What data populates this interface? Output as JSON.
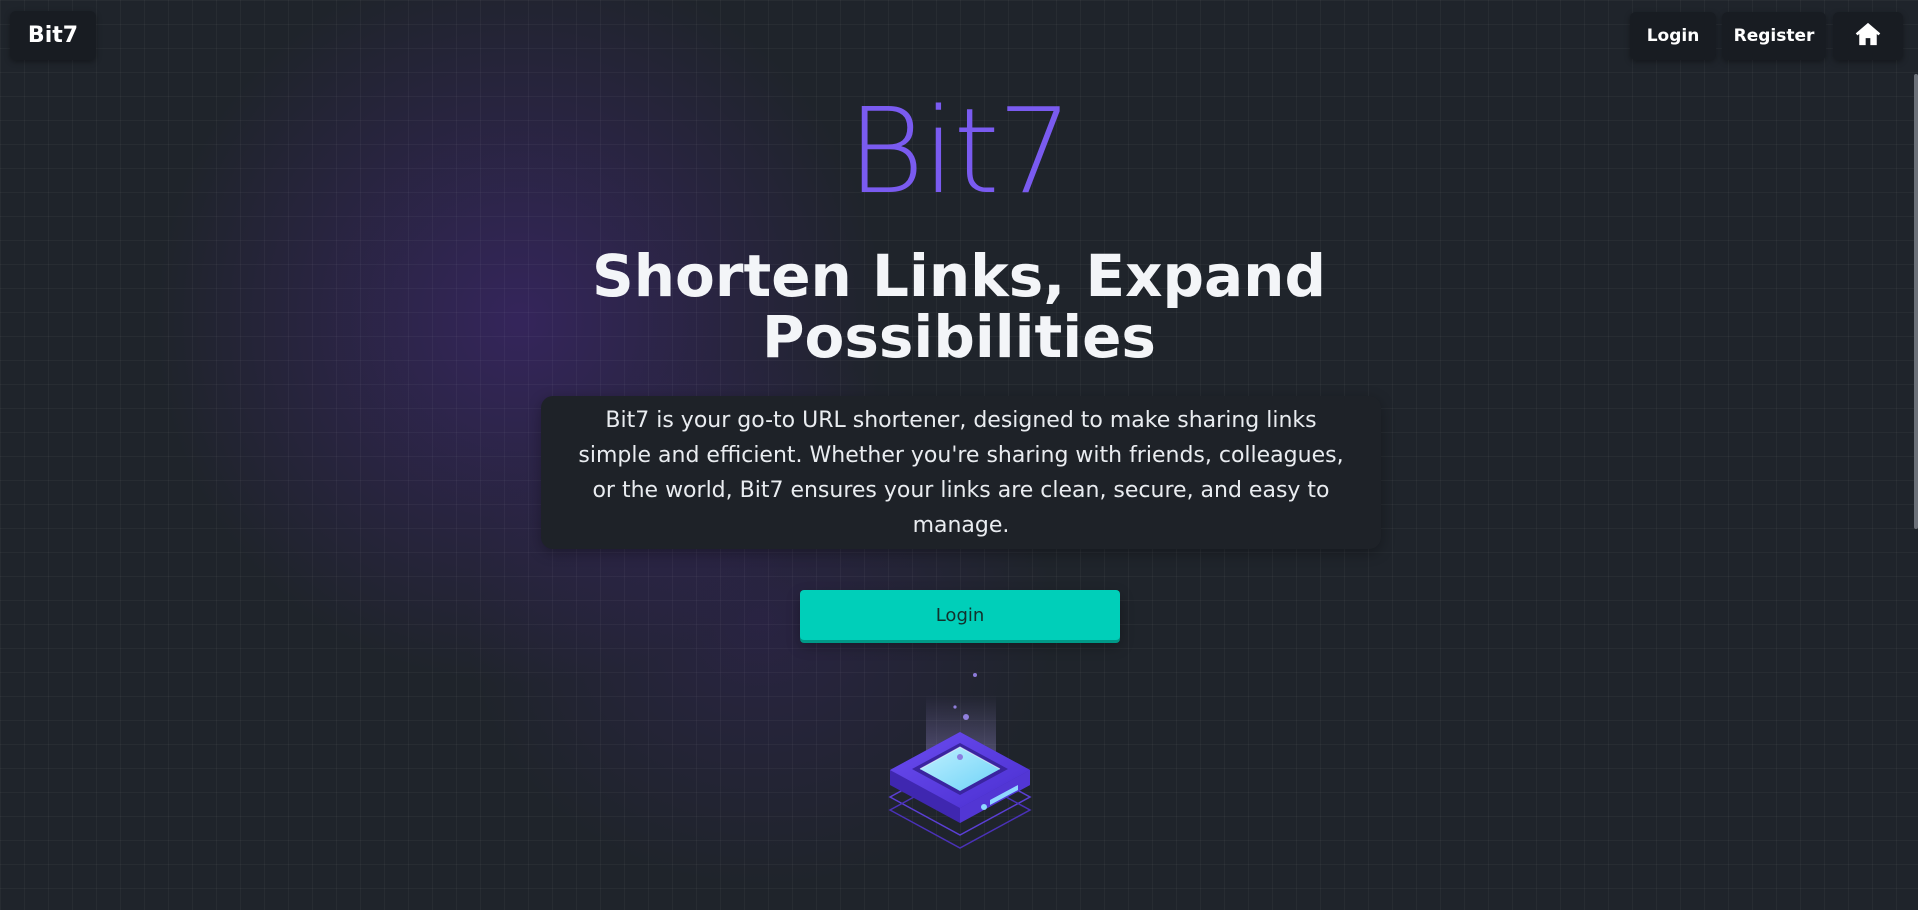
{
  "nav": {
    "brand": "Bit7",
    "login_label": "Login",
    "register_label": "Register",
    "home_icon": "home-icon"
  },
  "hero": {
    "logo_text": "Bit7",
    "headline_line1": "Shorten Links, Expand",
    "headline_line2": "Possibilities",
    "description": "Bit7 is your go-to URL shortener, designed to make sharing links simple and efficient. Whether you're sharing with friends, colleagues, or the world, Bit7 ensures your links are clean, secure, and easy to manage.",
    "cta_label": "Login",
    "illustration_icon": "isometric-device-icon"
  },
  "colors": {
    "background": "#1f242b",
    "accent_purple": "#7a5bf0",
    "cta_teal": "#00cfb9",
    "panel": "#181c22"
  }
}
